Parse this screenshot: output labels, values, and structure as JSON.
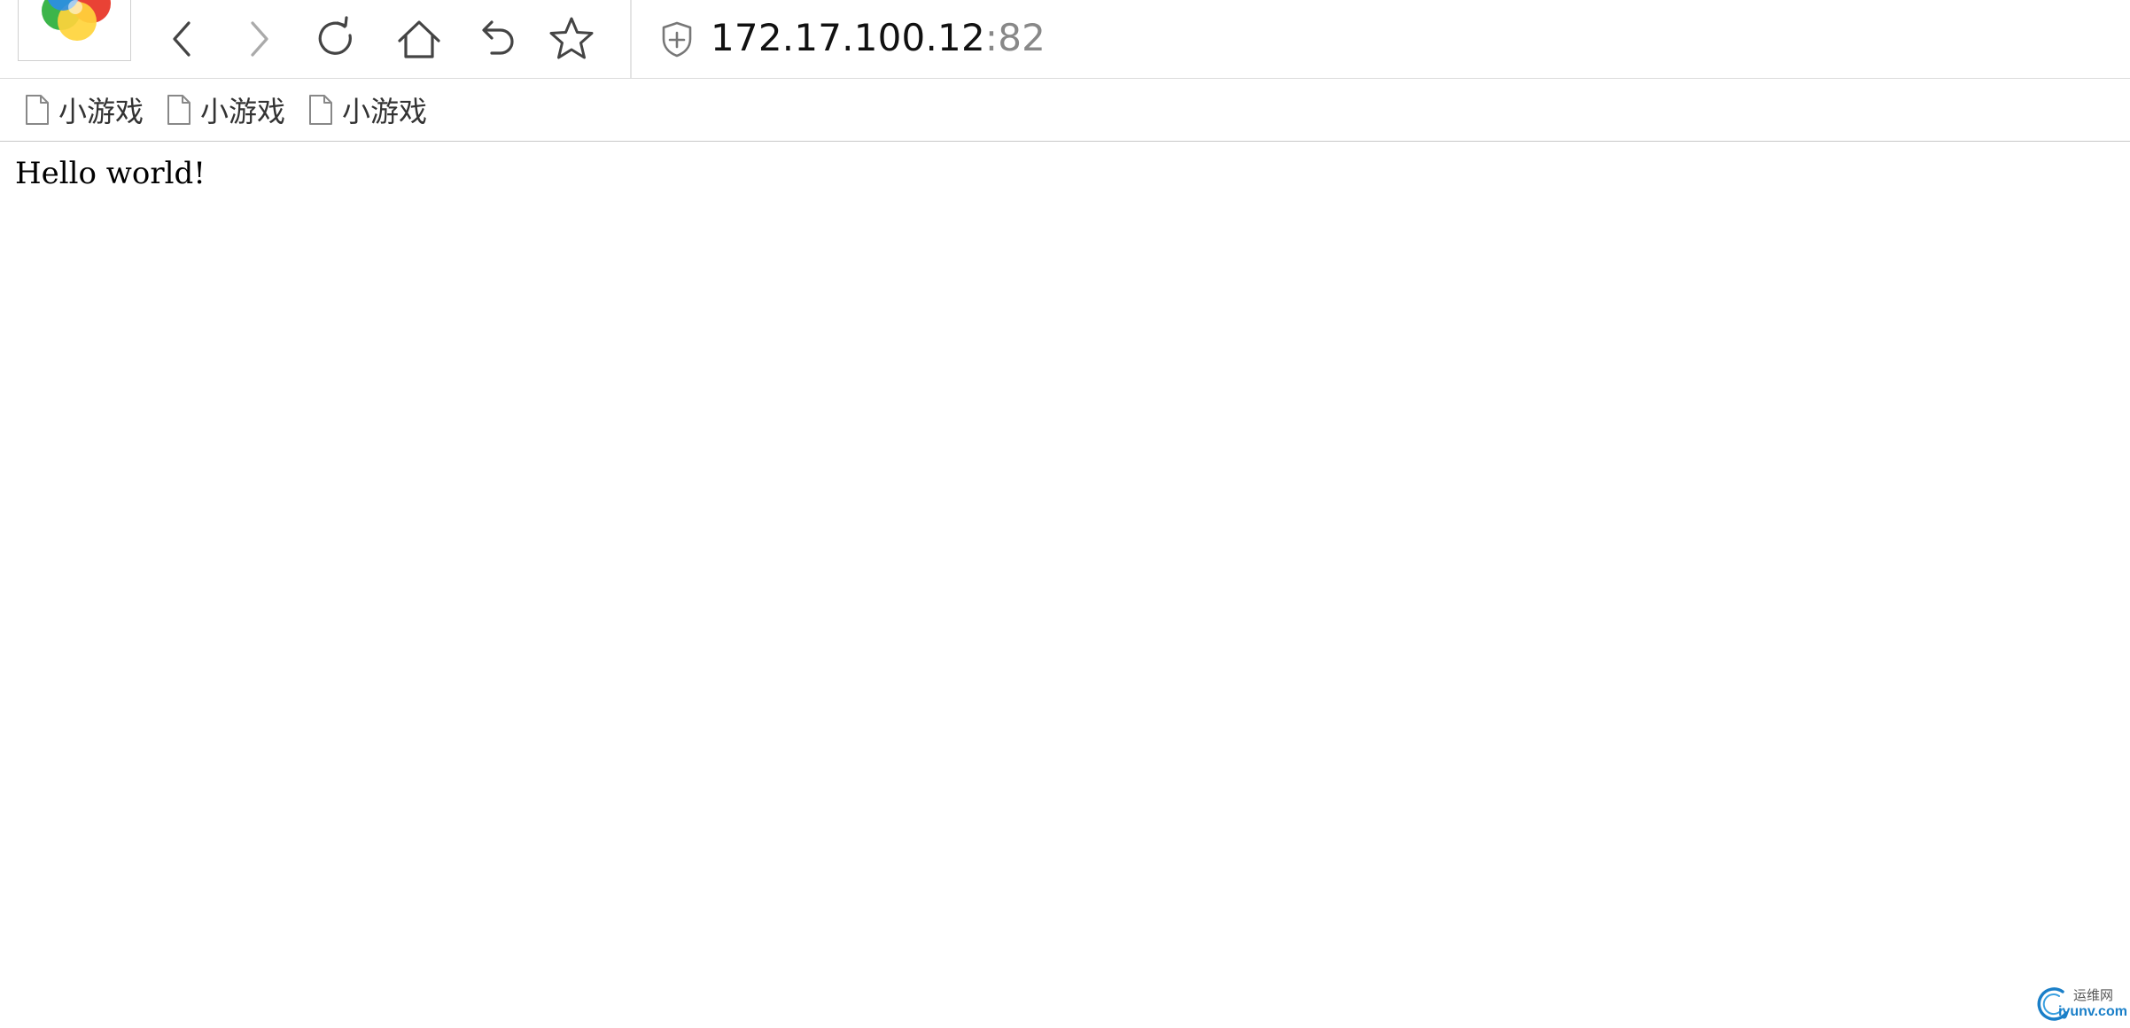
{
  "toolbar": {
    "logo_icon": "browser-logo-icon",
    "buttons": [
      {
        "name": "back-button",
        "icon": "chevron-left-icon",
        "enabled": true
      },
      {
        "name": "forward-button",
        "icon": "chevron-right-icon",
        "enabled": false
      },
      {
        "name": "reload-button",
        "icon": "refresh-icon",
        "enabled": true
      },
      {
        "name": "home-button",
        "icon": "home-icon",
        "enabled": true
      },
      {
        "name": "undo-button",
        "icon": "undo-icon",
        "enabled": true
      },
      {
        "name": "favorite-button",
        "icon": "star-icon",
        "enabled": true
      }
    ],
    "security_icon": "shield-plus-icon"
  },
  "address": {
    "host": "172.17.100.12",
    "port": ":82"
  },
  "bookmarks": [
    {
      "label": "小游戏",
      "icon": "page-icon"
    },
    {
      "label": "小游戏",
      "icon": "page-icon"
    },
    {
      "label": "小游戏",
      "icon": "page-icon"
    }
  ],
  "page": {
    "text": "Hello world!"
  },
  "watermark": {
    "cn": "运维网",
    "en": "iyunv.com"
  },
  "colors": {
    "icon_active": "#444444",
    "icon_disabled": "#aaaaaa",
    "port_text": "#888888",
    "watermark_blue": "#1a7fc8"
  }
}
